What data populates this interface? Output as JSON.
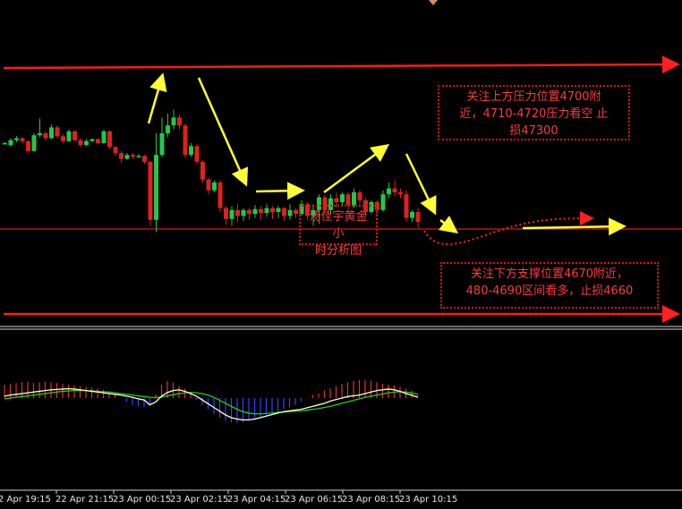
{
  "chart_data": {
    "type": "candlestick",
    "x_tick_labels": [
      "2 Apr 19:15",
      "22 Apr 21:15",
      "23 Apr 00:15",
      "23 Apr 02:15",
      "23 Apr 04:15",
      "23 Apr 06:15",
      "23 Apr 08:15",
      "23 Apr 10:15"
    ],
    "annotations": {
      "resistance_note": [
        "关注上方压力位置4700附",
        "近，4710-4720压力看空 止",
        "损47300"
      ],
      "support_note": [
        "关注下方支撑位置4670附近，",
        "480-4690区间看多，止损4660"
      ],
      "watermark": [
        "汤佳宇黄金小",
        "时分析图"
      ]
    },
    "colors": {
      "up_candle": "#22c84a",
      "down_candle": "#e02020",
      "level_line": "#ff1a1a",
      "arrow": "#ffff33",
      "macd_line": "#ffffcc",
      "signal_line": "#22cc22",
      "hist_up": "#e83030",
      "hist_down": "#3344ff"
    },
    "candles": [
      {
        "o": 0.0,
        "c": 0.0,
        "h": 0.01,
        "l": -0.01
      },
      {
        "o": -0.02,
        "c": 0.03,
        "h": 0.05,
        "l": -0.04
      },
      {
        "o": 0.03,
        "c": 0.05,
        "h": 0.07,
        "l": 0.01
      },
      {
        "o": 0.05,
        "c": 0.02,
        "h": 0.06,
        "l": 0.0
      },
      {
        "o": 0.02,
        "c": -0.08,
        "h": 0.03,
        "l": -0.1
      },
      {
        "o": -0.08,
        "c": 0.08,
        "h": 0.1,
        "l": -0.09
      },
      {
        "o": 0.08,
        "c": 0.1,
        "h": 0.25,
        "l": 0.06
      },
      {
        "o": 0.1,
        "c": 0.05,
        "h": 0.12,
        "l": 0.02
      },
      {
        "o": 0.05,
        "c": 0.16,
        "h": 0.19,
        "l": 0.04
      },
      {
        "o": 0.16,
        "c": 0.07,
        "h": 0.18,
        "l": 0.05
      },
      {
        "o": 0.07,
        "c": 0.02,
        "h": 0.09,
        "l": 0.0
      },
      {
        "o": 0.02,
        "c": 0.12,
        "h": 0.14,
        "l": 0.01
      },
      {
        "o": 0.12,
        "c": 0.03,
        "h": 0.13,
        "l": 0.02
      },
      {
        "o": 0.03,
        "c": -0.02,
        "h": 0.05,
        "l": -0.04
      },
      {
        "o": -0.02,
        "c": 0.02,
        "h": 0.04,
        "l": -0.03
      },
      {
        "o": 0.02,
        "c": 0.04,
        "h": 0.05,
        "l": 0.01
      },
      {
        "o": 0.04,
        "c": 0.0,
        "h": 0.05,
        "l": -0.01
      },
      {
        "o": 0.0,
        "c": 0.12,
        "h": 0.14,
        "l": -0.01
      },
      {
        "o": 0.12,
        "c": -0.04,
        "h": 0.13,
        "l": -0.06
      },
      {
        "o": -0.04,
        "c": -0.1,
        "h": -0.03,
        "l": -0.13
      },
      {
        "o": -0.1,
        "c": -0.16,
        "h": -0.08,
        "l": -0.2
      },
      {
        "o": -0.16,
        "c": -0.12,
        "h": -0.1,
        "l": -0.17
      },
      {
        "o": -0.12,
        "c": -0.14,
        "h": -0.1,
        "l": -0.16
      },
      {
        "o": -0.14,
        "c": -0.13,
        "h": -0.11,
        "l": -0.15
      },
      {
        "o": -0.13,
        "c": -0.19,
        "h": -0.12,
        "l": -0.21
      },
      {
        "o": -0.19,
        "c": -0.78,
        "h": -0.18,
        "l": -0.84
      },
      {
        "o": -0.78,
        "c": -0.12,
        "h": 0.1,
        "l": -0.9
      },
      {
        "o": -0.12,
        "c": 0.1,
        "h": 0.26,
        "l": -0.14
      },
      {
        "o": 0.1,
        "c": 0.18,
        "h": 0.3,
        "l": 0.06
      },
      {
        "o": 0.18,
        "c": 0.26,
        "h": 0.34,
        "l": 0.14
      },
      {
        "o": 0.26,
        "c": 0.18,
        "h": 0.29,
        "l": 0.14
      },
      {
        "o": 0.18,
        "c": -0.12,
        "h": 0.2,
        "l": -0.15
      },
      {
        "o": -0.12,
        "c": -0.03,
        "h": 0.0,
        "l": -0.14
      },
      {
        "o": -0.03,
        "c": -0.19,
        "h": -0.01,
        "l": -0.22
      },
      {
        "o": -0.19,
        "c": -0.37,
        "h": -0.17,
        "l": -0.4
      },
      {
        "o": -0.37,
        "c": -0.48,
        "h": -0.35,
        "l": -0.52
      },
      {
        "o": -0.48,
        "c": -0.4,
        "h": -0.38,
        "l": -0.5
      },
      {
        "o": -0.4,
        "c": -0.66,
        "h": -0.38,
        "l": -0.7
      },
      {
        "o": -0.66,
        "c": -0.77,
        "h": -0.64,
        "l": -0.83
      },
      {
        "o": -0.77,
        "c": -0.68,
        "h": -0.64,
        "l": -0.84
      },
      {
        "o": -0.68,
        "c": -0.74,
        "h": -0.62,
        "l": -0.8
      },
      {
        "o": -0.74,
        "c": -0.68,
        "h": -0.66,
        "l": -0.79
      },
      {
        "o": -0.68,
        "c": -0.72,
        "h": -0.66,
        "l": -0.78
      },
      {
        "o": -0.72,
        "c": -0.67,
        "h": -0.63,
        "l": -0.76
      },
      {
        "o": -0.67,
        "c": -0.71,
        "h": -0.64,
        "l": -0.78
      },
      {
        "o": -0.71,
        "c": -0.66,
        "h": -0.62,
        "l": -0.75
      },
      {
        "o": -0.66,
        "c": -0.7,
        "h": -0.64,
        "l": -0.77
      },
      {
        "o": -0.7,
        "c": -0.66,
        "h": -0.64,
        "l": -0.76
      },
      {
        "o": -0.66,
        "c": -0.74,
        "h": -0.65,
        "l": -0.79
      },
      {
        "o": -0.74,
        "c": -0.68,
        "h": -0.62,
        "l": -0.78
      },
      {
        "o": -0.68,
        "c": -0.72,
        "h": -0.66,
        "l": -0.76
      },
      {
        "o": -0.72,
        "c": -0.62,
        "h": -0.58,
        "l": -0.74
      },
      {
        "o": -0.62,
        "c": -0.74,
        "h": -0.6,
        "l": -0.78
      },
      {
        "o": -0.74,
        "c": -0.68,
        "h": -0.62,
        "l": -0.84
      },
      {
        "o": -0.68,
        "c": -0.55,
        "h": -0.52,
        "l": -0.82
      },
      {
        "o": -0.55,
        "c": -0.68,
        "h": -0.53,
        "l": -0.72
      },
      {
        "o": -0.68,
        "c": -0.56,
        "h": -0.52,
        "l": -0.72
      },
      {
        "o": -0.56,
        "c": -0.6,
        "h": -0.5,
        "l": -0.66
      },
      {
        "o": -0.6,
        "c": -0.52,
        "h": -0.5,
        "l": -0.64
      },
      {
        "o": -0.52,
        "c": -0.63,
        "h": -0.5,
        "l": -0.67
      },
      {
        "o": -0.63,
        "c": -0.5,
        "h": -0.46,
        "l": -0.66
      },
      {
        "o": -0.5,
        "c": -0.58,
        "h": -0.48,
        "l": -0.62
      },
      {
        "o": -0.58,
        "c": -0.7,
        "h": -0.56,
        "l": -0.74
      },
      {
        "o": -0.7,
        "c": -0.6,
        "h": -0.58,
        "l": -0.72
      },
      {
        "o": -0.6,
        "c": -0.68,
        "h": -0.58,
        "l": -0.74
      },
      {
        "o": -0.68,
        "c": -0.52,
        "h": -0.48,
        "l": -0.7
      },
      {
        "o": -0.52,
        "c": -0.46,
        "h": -0.4,
        "l": -0.56
      },
      {
        "o": -0.46,
        "c": -0.5,
        "h": -0.38,
        "l": -0.54
      },
      {
        "o": -0.5,
        "c": -0.52,
        "h": -0.46,
        "l": -0.56
      },
      {
        "o": -0.52,
        "c": -0.76,
        "h": -0.48,
        "l": -0.8
      },
      {
        "o": -0.76,
        "c": -0.7,
        "h": -0.68,
        "l": -0.8
      },
      {
        "o": -0.7,
        "c": -0.8,
        "h": -0.66,
        "l": -0.86
      }
    ],
    "macd": {
      "histogram": [
        0.35,
        0.38,
        0.4,
        0.42,
        0.43,
        0.4,
        0.42,
        0.44,
        0.42,
        0.4,
        0.38,
        0.36,
        0.34,
        0.32,
        0.3,
        0.28,
        0.26,
        0.22,
        0.18,
        0.1,
        0.0,
        -0.1,
        -0.18,
        -0.22,
        -0.24,
        -0.2,
        0.1,
        0.35,
        0.45,
        0.42,
        0.32,
        0.25,
        0.12,
        -0.05,
        -0.18,
        -0.3,
        -0.42,
        -0.52,
        -0.6,
        -0.65,
        -0.66,
        -0.64,
        -0.6,
        -0.55,
        -0.5,
        -0.45,
        -0.4,
        -0.36,
        -0.3,
        -0.25,
        -0.18,
        -0.1,
        0.0,
        0.08,
        0.12,
        0.2,
        0.26,
        0.32,
        0.38,
        0.42,
        0.45,
        0.48,
        0.48,
        0.46,
        0.42,
        0.38,
        0.36,
        0.34,
        0.3,
        0.25,
        0.2,
        0.1
      ],
      "macd_line": [
        0.05,
        0.08,
        0.1,
        0.12,
        0.14,
        0.16,
        0.18,
        0.2,
        0.22,
        0.23,
        0.24,
        0.25,
        0.24,
        0.22,
        0.2,
        0.18,
        0.16,
        0.14,
        0.12,
        0.1,
        0.08,
        0.05,
        0.02,
        -0.02,
        -0.05,
        -0.18,
        -0.1,
        0.05,
        0.15,
        0.2,
        0.22,
        0.18,
        0.12,
        0.05,
        -0.05,
        -0.15,
        -0.25,
        -0.35,
        -0.45,
        -0.52,
        -0.56,
        -0.58,
        -0.58,
        -0.56,
        -0.52,
        -0.48,
        -0.44,
        -0.4,
        -0.36,
        -0.34,
        -0.32,
        -0.3,
        -0.26,
        -0.22,
        -0.18,
        -0.14,
        -0.08,
        -0.04,
        0.0,
        0.04,
        0.06,
        0.08,
        0.12,
        0.16,
        0.2,
        0.22,
        0.24,
        0.22,
        0.18,
        0.12,
        0.08,
        0.02
      ],
      "signal_line": [
        -0.02,
        0.0,
        0.02,
        0.04,
        0.06,
        0.08,
        0.1,
        0.12,
        0.14,
        0.16,
        0.18,
        0.19,
        0.2,
        0.2,
        0.2,
        0.19,
        0.18,
        0.17,
        0.16,
        0.14,
        0.12,
        0.1,
        0.08,
        0.06,
        0.04,
        0.02,
        0.01,
        0.03,
        0.06,
        0.09,
        0.12,
        0.14,
        0.15,
        0.14,
        0.12,
        0.08,
        0.02,
        -0.06,
        -0.14,
        -0.22,
        -0.3,
        -0.36,
        -0.4,
        -0.42,
        -0.42,
        -0.41,
        -0.4,
        -0.38,
        -0.37,
        -0.36,
        -0.35,
        -0.34,
        -0.32,
        -0.3,
        -0.28,
        -0.25,
        -0.22,
        -0.18,
        -0.14,
        -0.1,
        -0.06,
        -0.02,
        0.02,
        0.05,
        0.08,
        0.11,
        0.14,
        0.16,
        0.17,
        0.16,
        0.14,
        0.1
      ]
    }
  }
}
